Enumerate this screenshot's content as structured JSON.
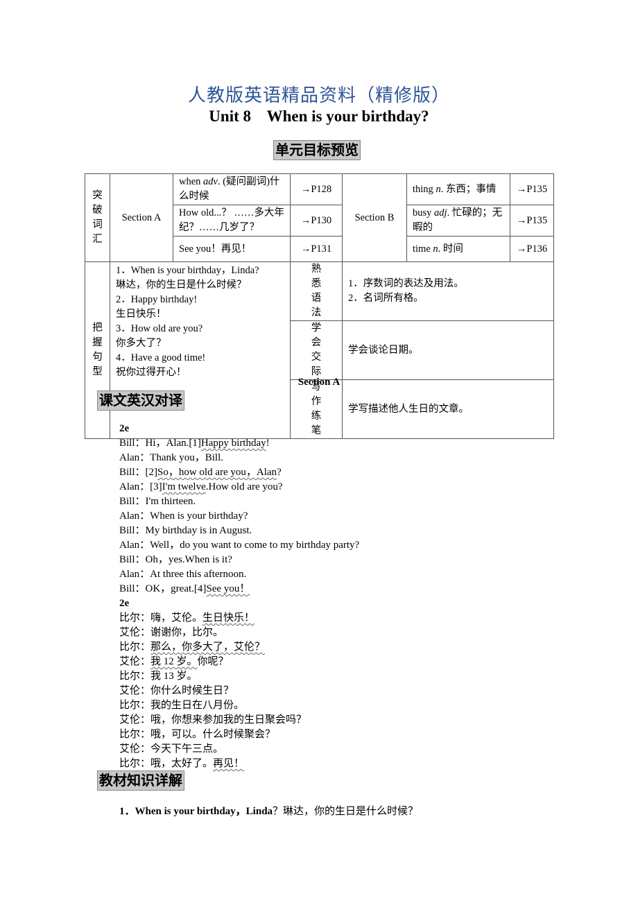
{
  "header": {
    "title_cn": "人教版英语精品资料（精修版）",
    "title_en": "Unit 8    When is your birthday?"
  },
  "section_heading_1": "单元目标预览",
  "table": {
    "vocab_label": "突破词汇",
    "section_a": "Section A",
    "section_b": "Section B",
    "a_items": [
      {
        "text_html": "when <i>adv</i>. (疑问副词)什么时候",
        "ref": "→P128"
      },
      {
        "text_html": "How old...？ ……多大年纪？……几岁了？",
        "ref": "→P130"
      },
      {
        "text_html": "See you！再见！",
        "ref": "→P131"
      }
    ],
    "b_items": [
      {
        "text_html": "thing <i>n</i>. 东西；事情",
        "ref": "→P135"
      },
      {
        "text_html": "busy <i>adj</i>. 忙碌的；无暇的",
        "ref": "→P135"
      },
      {
        "text_html": "time <i>n</i>. 时间",
        "ref": "→P136"
      }
    ],
    "sentence_label": "把握句型",
    "sentences": [
      "1．When is your birthday，Linda?",
      "琳达，你的生日是什么时候？",
      "2．Happy birthday!",
      "生日快乐！",
      "3．How old are you?",
      "你多大了？",
      "4．Have a good time!",
      "祝你过得开心！"
    ],
    "goals": [
      {
        "label": "熟悉语法",
        "content": [
          "1．序数词的表达及用法。",
          "2．名词所有格。"
        ]
      },
      {
        "label": "学会交际",
        "content": [
          "学会谈论日期。"
        ]
      },
      {
        "label": "写作练笔",
        "content": [
          "学写描述他人生日的文章。"
        ]
      }
    ]
  },
  "section_a_label": "Section A",
  "section_heading_2": "课文英汉对译",
  "dialog": [
    {
      "bold": true,
      "parts": [
        {
          "t": "2e"
        }
      ]
    },
    {
      "parts": [
        {
          "t": "Bill：Hi，Alan.[1]"
        },
        {
          "t": "Happy birthday",
          "u": true
        },
        {
          "t": "!"
        }
      ]
    },
    {
      "parts": [
        {
          "t": "Alan：Thank you，Bill."
        }
      ]
    },
    {
      "parts": [
        {
          "t": "Bill：[2]"
        },
        {
          "t": "So，how old are you，Alan",
          "u": true
        },
        {
          "t": "?"
        }
      ]
    },
    {
      "parts": [
        {
          "t": "Alan：[3]"
        },
        {
          "t": "I'm twelve",
          "u": true
        },
        {
          "t": ".How old are you?"
        }
      ]
    },
    {
      "parts": [
        {
          "t": "Bill：I'm thirteen."
        }
      ]
    },
    {
      "parts": [
        {
          "t": "Alan：When is your birthday?"
        }
      ]
    },
    {
      "parts": [
        {
          "t": "Bill：My birthday is in August."
        }
      ]
    },
    {
      "parts": [
        {
          "t": "Alan：Well，do you want to come to my birthday party?"
        }
      ]
    },
    {
      "parts": [
        {
          "t": "Bill：Oh，yes.When is it?"
        }
      ]
    },
    {
      "parts": [
        {
          "t": "Alan：At three this afternoon."
        }
      ]
    },
    {
      "parts": [
        {
          "t": "Bill：OK，great.[4]"
        },
        {
          "t": "See you！",
          "u": true
        }
      ]
    },
    {
      "bold": true,
      "parts": [
        {
          "t": "2e"
        }
      ]
    },
    {
      "parts": [
        {
          "t": "比尔：嗨，艾伦。"
        },
        {
          "t": "生日快乐！",
          "u": true
        }
      ]
    },
    {
      "parts": [
        {
          "t": "艾伦：谢谢你，比尔。"
        }
      ]
    },
    {
      "parts": [
        {
          "t": "比尔："
        },
        {
          "t": "那么，你多大了，艾伦？",
          "u": true
        }
      ]
    },
    {
      "parts": [
        {
          "t": "艾伦："
        },
        {
          "t": "我 12 岁。",
          "u": true
        },
        {
          "t": "你呢？"
        }
      ]
    },
    {
      "parts": [
        {
          "t": "比尔：我 13 岁。"
        }
      ]
    },
    {
      "parts": [
        {
          "t": "艾伦：你什么时候生日？"
        }
      ]
    },
    {
      "parts": [
        {
          "t": "比尔：我的生日在八月份。"
        }
      ]
    },
    {
      "parts": [
        {
          "t": "艾伦：哦，你想来参加我的生日聚会吗？"
        }
      ]
    },
    {
      "parts": [
        {
          "t": "比尔：哦，可以。什么时候聚会？"
        }
      ]
    },
    {
      "parts": [
        {
          "t": "艾伦：今天下午三点。"
        }
      ]
    },
    {
      "parts": [
        {
          "t": "比尔：哦，太好了。"
        },
        {
          "t": "再见！",
          "u": true
        }
      ]
    }
  ],
  "section_heading_3": "教材知识详解",
  "point_1": {
    "en": "1．When is your birthday，Linda",
    "cn": "？琳达，你的生日是什么时候？"
  }
}
